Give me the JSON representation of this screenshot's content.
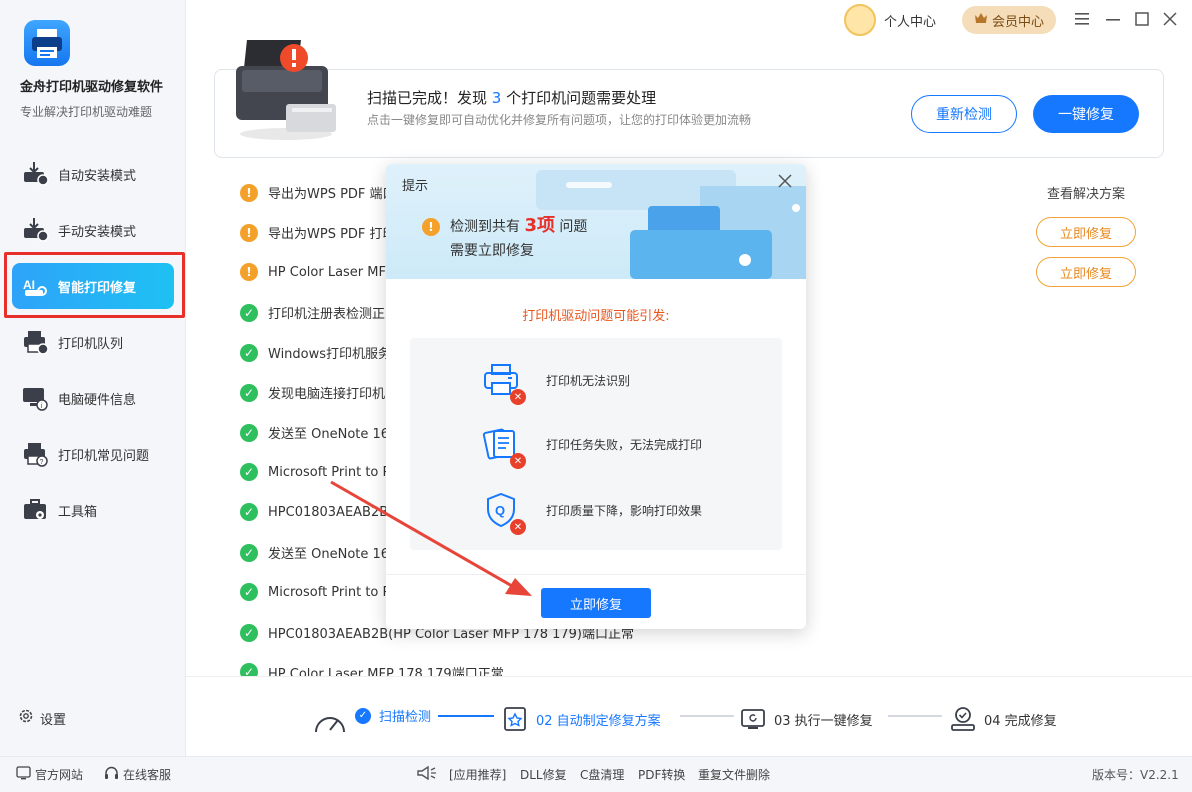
{
  "app": {
    "name": "金舟打印机驱动修复软件",
    "subtitle": "专业解决打印机驱动难题"
  },
  "sidebar": {
    "items": [
      {
        "label": "自动安装模式",
        "icon": "printer-download-icon"
      },
      {
        "label": "手动安装模式",
        "icon": "printer-manual-icon"
      },
      {
        "label": "智能打印修复",
        "icon": "ai-repair-icon"
      },
      {
        "label": "打印机队列",
        "icon": "printer-queue-icon"
      },
      {
        "label": "电脑硬件信息",
        "icon": "monitor-info-icon"
      },
      {
        "label": "打印机常见问题",
        "icon": "printer-help-icon"
      },
      {
        "label": "工具箱",
        "icon": "toolbox-icon"
      }
    ],
    "active_index": 2,
    "settings_label": "设置"
  },
  "topbar": {
    "user_label": "个人中心",
    "vip_label": "会员中心"
  },
  "scan": {
    "title_prefix": "扫描已完成！发现 ",
    "count": "3",
    "title_suffix": " 个打印机问题需要处理",
    "subtitle": "点击一键修复即可自动优化并修复所有问题项，让您的打印体验更加流畅",
    "rescan_label": "重新检测",
    "fix_all_label": "一键修复"
  },
  "issues": {
    "view_solution_label": "查看解决方案",
    "fix_label": "立即修复",
    "rows": [
      {
        "text": "导出为WPS PDF 端口",
        "status": "warning"
      },
      {
        "text": "导出为WPS PDF 打印",
        "status": "warning"
      },
      {
        "text": "HP Color Laser MFP",
        "status": "warning"
      },
      {
        "text": "打印机注册表检测正",
        "status": "ok"
      },
      {
        "text": "Windows打印机服务",
        "status": "ok"
      },
      {
        "text": "发现电脑连接打印机",
        "status": "ok"
      },
      {
        "text": "发送至 OneNote 16",
        "status": "ok"
      },
      {
        "text": "Microsoft Print to P",
        "status": "ok"
      },
      {
        "text": "HPC01803AEAB2B(",
        "status": "ok"
      },
      {
        "text": "发送至 OneNote 16",
        "status": "ok"
      },
      {
        "text": "Microsoft Print to P",
        "status": "ok"
      },
      {
        "text": "HPC01803AEAB2B(HP Color Laser MFP 178 179)端口正常",
        "status": "ok"
      },
      {
        "text": "HP Color Laser MFP 178 179端口正常",
        "status": "ok"
      }
    ]
  },
  "steps": [
    {
      "label": "扫描检测",
      "state": "done"
    },
    {
      "label": "02 自动制定修复方案",
      "state": "active"
    },
    {
      "label": "03 执行一键修复",
      "state": "pending"
    },
    {
      "label": "04 完成修复",
      "state": "pending"
    }
  ],
  "modal": {
    "title": "提示",
    "message_prefix": "检测到共有 ",
    "count": "3项",
    "message_suffix": " 问题",
    "message_line2": "需要立即修复",
    "causes_title": "打印机驱动问题可能引发:",
    "causes": [
      {
        "text": "打印机无法识别",
        "icon": "printer-error-icon"
      },
      {
        "text": "打印任务失败，无法完成打印",
        "icon": "document-error-icon"
      },
      {
        "text": "打印质量下降，影响打印效果",
        "icon": "quality-shield-error-icon"
      }
    ],
    "fix_label": "立即修复"
  },
  "footer": {
    "website_label": "官方网站",
    "support_label": "在线客服",
    "links": [
      "[应用推荐]",
      "DLL修复",
      "C盘清理",
      "PDF转换",
      "重复文件删除"
    ],
    "version": "版本号：V2.2.1"
  },
  "colors": {
    "accent": "#1677ff",
    "warning": "#f4a12b",
    "ok": "#2fbf5f",
    "danger": "#e8302a",
    "fix_button": "#e8891f"
  }
}
